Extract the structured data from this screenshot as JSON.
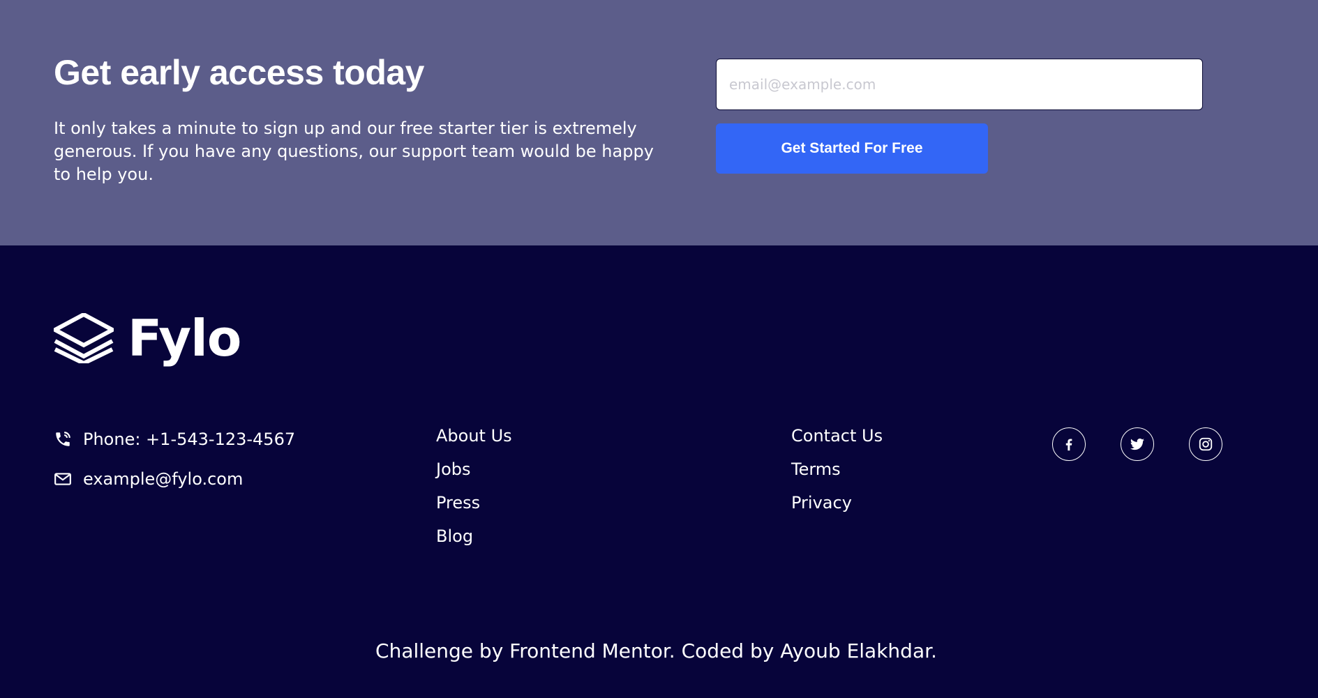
{
  "cta": {
    "title": "Get early access today",
    "description": "It only takes a minute to sign up and our free starter tier is extremely generous. If you have any questions, our support team would be happy to help you.",
    "email_placeholder": "email@example.com",
    "email_value": "",
    "button_label": "Get Started For Free"
  },
  "footer": {
    "logo_text": "Fylo",
    "contact": {
      "phone": "Phone: +1-543-123-4567",
      "email": "example@fylo.com"
    },
    "links_col1": [
      "About Us",
      "Jobs",
      "Press",
      "Blog"
    ],
    "links_col2": [
      "Contact Us",
      "Terms",
      "Privacy"
    ],
    "social_icons": [
      "facebook-icon",
      "twitter-icon",
      "instagram-icon"
    ],
    "credit": "Challenge by Frontend Mentor. Coded by Ayoub Elakhdar."
  },
  "colors": {
    "cta_background": "#5c5d8a",
    "footer_background": "#07043a",
    "button": "#3366f6",
    "text": "#ffffff"
  }
}
